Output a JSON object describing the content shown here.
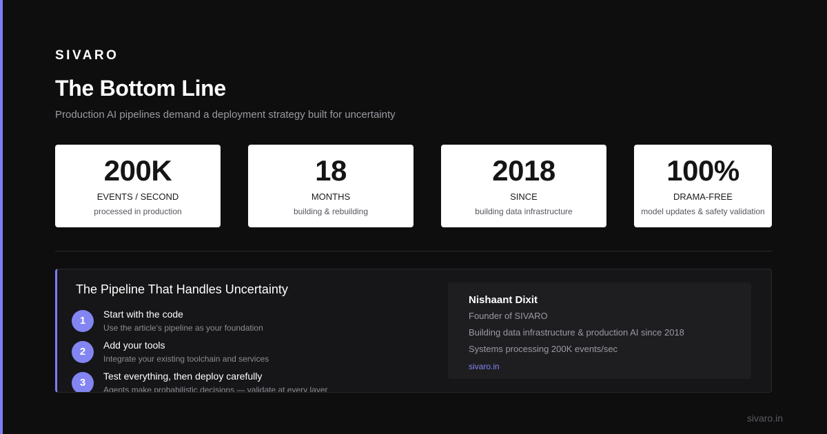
{
  "brand": "SIVARO",
  "title": "The Bottom Line",
  "subtitle": "Production AI pipelines demand a deployment strategy built for uncertainty",
  "stats": [
    {
      "value": "200K",
      "label": "EVENTS / SECOND",
      "desc": "processed in production"
    },
    {
      "value": "18",
      "label": "MONTHS",
      "desc": "building & rebuilding"
    },
    {
      "value": "2018",
      "label": "SINCE",
      "desc": "building data infrastructure"
    },
    {
      "value": "100%",
      "label": "DRAMA-FREE",
      "desc": "model updates & safety validation"
    }
  ],
  "pipeline": {
    "title": "The Pipeline That Handles Uncertainty",
    "steps": [
      {
        "num": "1",
        "title": "Start with the code",
        "desc": "Use the article's pipeline as your foundation"
      },
      {
        "num": "2",
        "title": "Add your tools",
        "desc": "Integrate your existing toolchain and services"
      },
      {
        "num": "3",
        "title": "Test everything, then deploy carefully",
        "desc": "Agents make probabilistic decisions — validate at every layer"
      }
    ]
  },
  "author": {
    "name": "Nishaant Dixit",
    "role": "Founder of SIVARO",
    "line1": "Building data infrastructure & production AI since 2018",
    "line2": "Systems processing 200K events/sec",
    "link": "sivaro.in"
  },
  "footer": {
    "site": "sivaro.in"
  },
  "colors": {
    "accent": "#7c7ff4",
    "background": "#0e0e0f",
    "card": "#ffffff"
  }
}
